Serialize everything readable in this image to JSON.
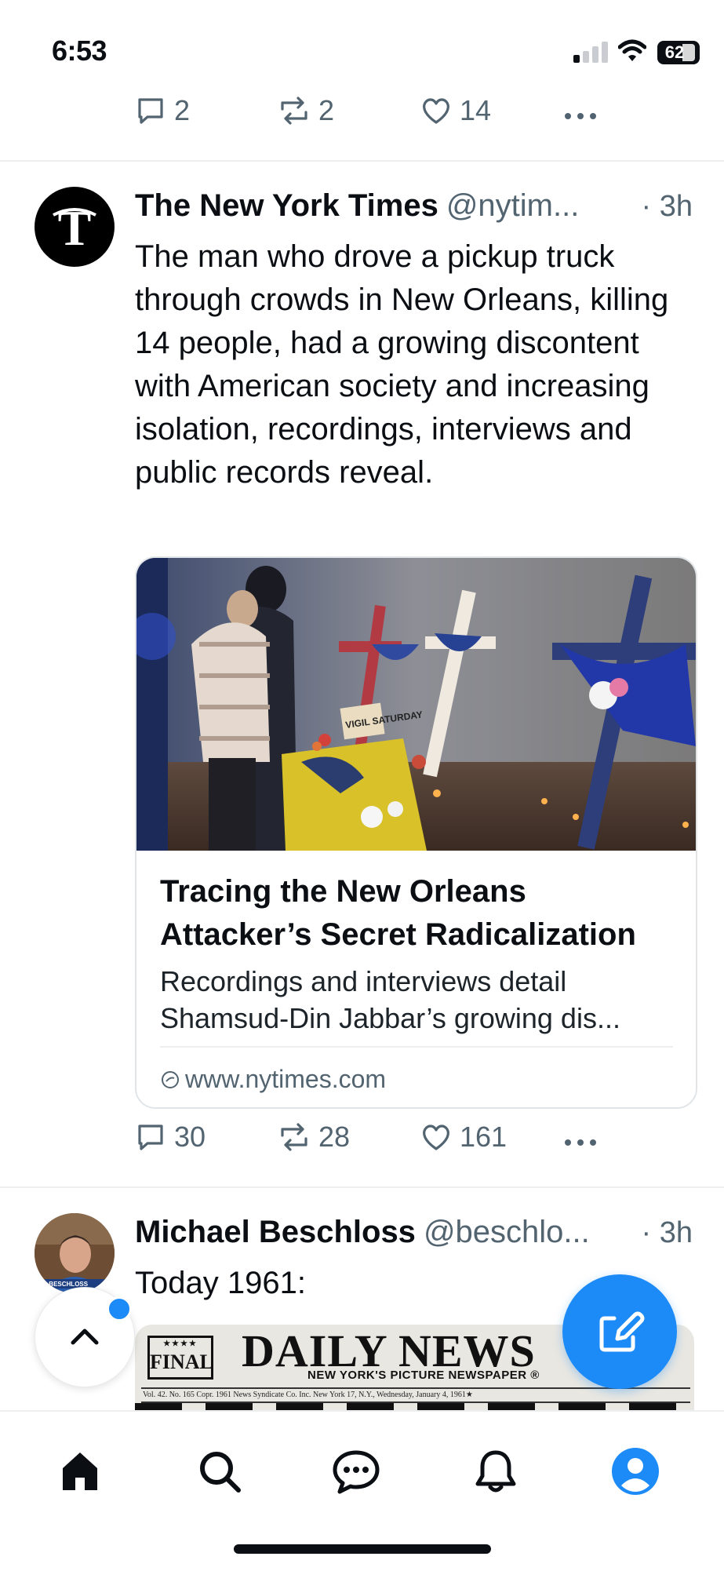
{
  "status_bar": {
    "time": "6:53",
    "battery": "62"
  },
  "previous_tweet": {
    "actions": {
      "replies": "2",
      "reposts": "2",
      "likes": "14"
    }
  },
  "tweet1": {
    "author_name": "The New York Times",
    "handle": "@nytim...",
    "time": "· 3h",
    "text": "The man who drove a pickup truck through crowds in New Orleans, killing 14 people, had a growing discontent with American society and increasing isolation, recordings, interviews and public records reveal.",
    "card": {
      "title": "Tracing the New Orleans Attacker’s Secret Radicalization",
      "description": "Recordings and interviews detail Shamsud-Din Jabbar’s growing dis...",
      "domain": "www.nytimes.com",
      "image_sign": "VIGIL SATURDAY"
    },
    "actions": {
      "replies": "30",
      "reposts": "28",
      "likes": "161"
    }
  },
  "tweet2": {
    "author_name": "Michael Beschloss",
    "handle": "@beschlo...",
    "time": "· 3h",
    "text": "Today 1961:",
    "avatar_caption": "EL BESCHLOSS",
    "newspaper": {
      "edition": "FINAL",
      "stars": "★★★★",
      "title": "DAILY NEWS",
      "subtitle": "NEW YORK'S PICTURE NEWSPAPER ®",
      "dateline": "Vol. 42. No. 165     Copr. 1961 News Syndicate Co. Inc.          New York 17, N.Y., Wednesday, January 4, 1961★"
    }
  },
  "colors": {
    "accent": "#1d8bf7",
    "muted": "#536471",
    "text": "#0b0f14",
    "divider": "#eceef0"
  },
  "tab_bar": {
    "items": [
      "home-icon",
      "search-icon",
      "messages-icon",
      "notifications-icon",
      "profile-icon"
    ]
  }
}
